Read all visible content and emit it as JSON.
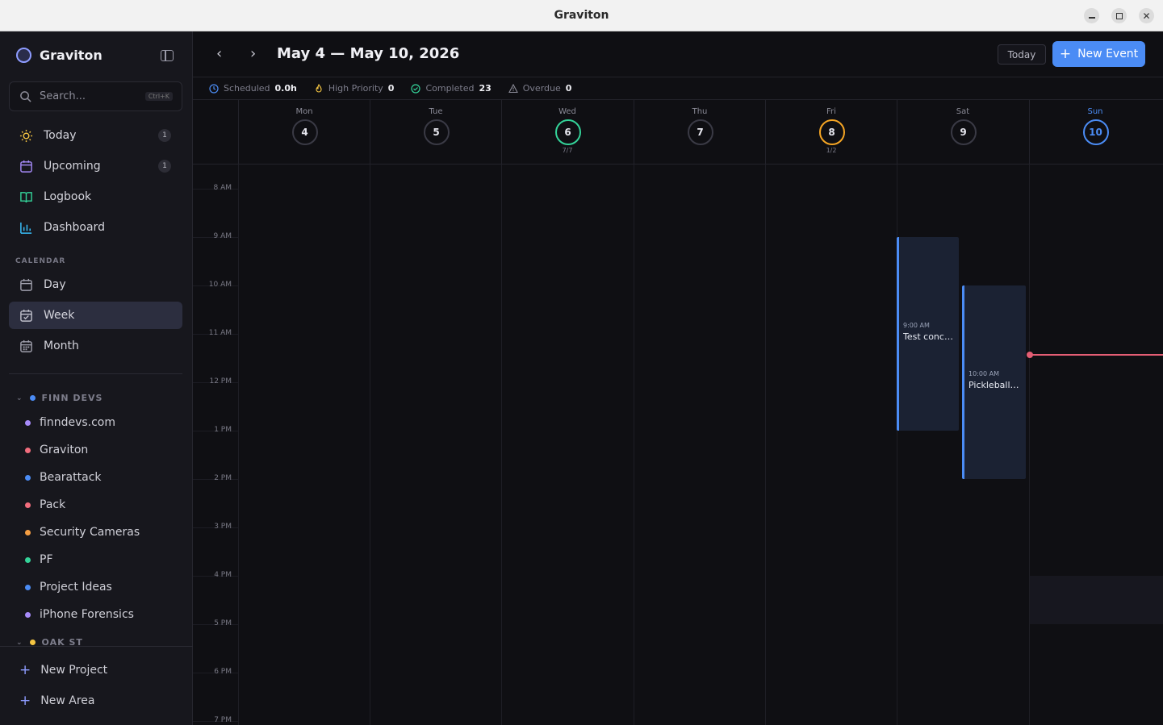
{
  "window": {
    "title": "Graviton"
  },
  "sidebar": {
    "app_name": "Graviton",
    "search": {
      "placeholder": "Search...",
      "shortcut": "Ctrl+K"
    },
    "nav": [
      {
        "label": "Today",
        "icon": "sun-icon",
        "badge": "1"
      },
      {
        "label": "Upcoming",
        "icon": "calendar-icon",
        "badge": "1"
      },
      {
        "label": "Logbook",
        "icon": "book-icon"
      },
      {
        "label": "Dashboard",
        "icon": "bar-chart-icon"
      }
    ],
    "calendar_label": "CALENDAR",
    "calendar_views": [
      {
        "label": "Day",
        "icon": "calendar-icon"
      },
      {
        "label": "Week",
        "icon": "calendar-check-icon",
        "active": true
      },
      {
        "label": "Month",
        "icon": "calendar-grid-icon"
      }
    ],
    "areas": [
      {
        "name": "FINN DEVS",
        "color": "#4b8cf5",
        "projects": [
          {
            "name": "finndevs.com",
            "color": "#a78bfa"
          },
          {
            "name": "Graviton",
            "color": "#f26d7d"
          },
          {
            "name": "Bearattack",
            "color": "#4b8cf5"
          },
          {
            "name": "Pack",
            "color": "#f26d7d"
          },
          {
            "name": "Security Cameras",
            "color": "#f59e42"
          },
          {
            "name": "PF",
            "color": "#34d399"
          },
          {
            "name": "Project Ideas",
            "color": "#4b8cf5"
          },
          {
            "name": "iPhone Forensics",
            "color": "#a78bfa"
          }
        ]
      },
      {
        "name": "OAK ST",
        "color": "#f5c542",
        "projects": []
      }
    ],
    "footer": {
      "new_project": "New Project",
      "new_area": "New Area"
    }
  },
  "header": {
    "range_title": "May 4 — May 10, 2026",
    "today_label": "Today",
    "new_event_label": "New Event"
  },
  "stats": [
    {
      "label": "Scheduled",
      "value": "0.0h",
      "icon": "clock-icon",
      "color": "#4b8cf5"
    },
    {
      "label": "High Priority",
      "value": "0",
      "icon": "flame-icon",
      "color": "#f5c542"
    },
    {
      "label": "Completed",
      "value": "23",
      "icon": "check-circle-icon",
      "color": "#34d399"
    },
    {
      "label": "Overdue",
      "value": "0",
      "icon": "warning-icon",
      "color": "#8a8a96"
    }
  ],
  "days": [
    {
      "name": "Mon",
      "num": "4",
      "ring": "#3a3a45"
    },
    {
      "name": "Tue",
      "num": "5",
      "ring": "#3a3a45"
    },
    {
      "name": "Wed",
      "num": "6",
      "ring": "#34d399",
      "sub": "7/7"
    },
    {
      "name": "Thu",
      "num": "7",
      "ring": "#3a3a45"
    },
    {
      "name": "Fri",
      "num": "8",
      "ring": "#f5a524",
      "sub": "1/2"
    },
    {
      "name": "Sat",
      "num": "9",
      "ring": "#3a3a45"
    },
    {
      "name": "Sun",
      "num": "10",
      "ring": "#4b8cf5",
      "today": true
    }
  ],
  "hours": [
    "8 AM",
    "9 AM",
    "10 AM",
    "11 AM",
    "12 PM",
    "1 PM",
    "2 PM",
    "3 PM",
    "4 PM",
    "5 PM",
    "6 PM",
    "7 PM"
  ],
  "events": [
    {
      "time": "9:00 AM",
      "title": "Test concidi...",
      "day": "Sat"
    },
    {
      "time": "10:00 AM",
      "title": "Pickleball h...",
      "day": "Sat"
    }
  ]
}
